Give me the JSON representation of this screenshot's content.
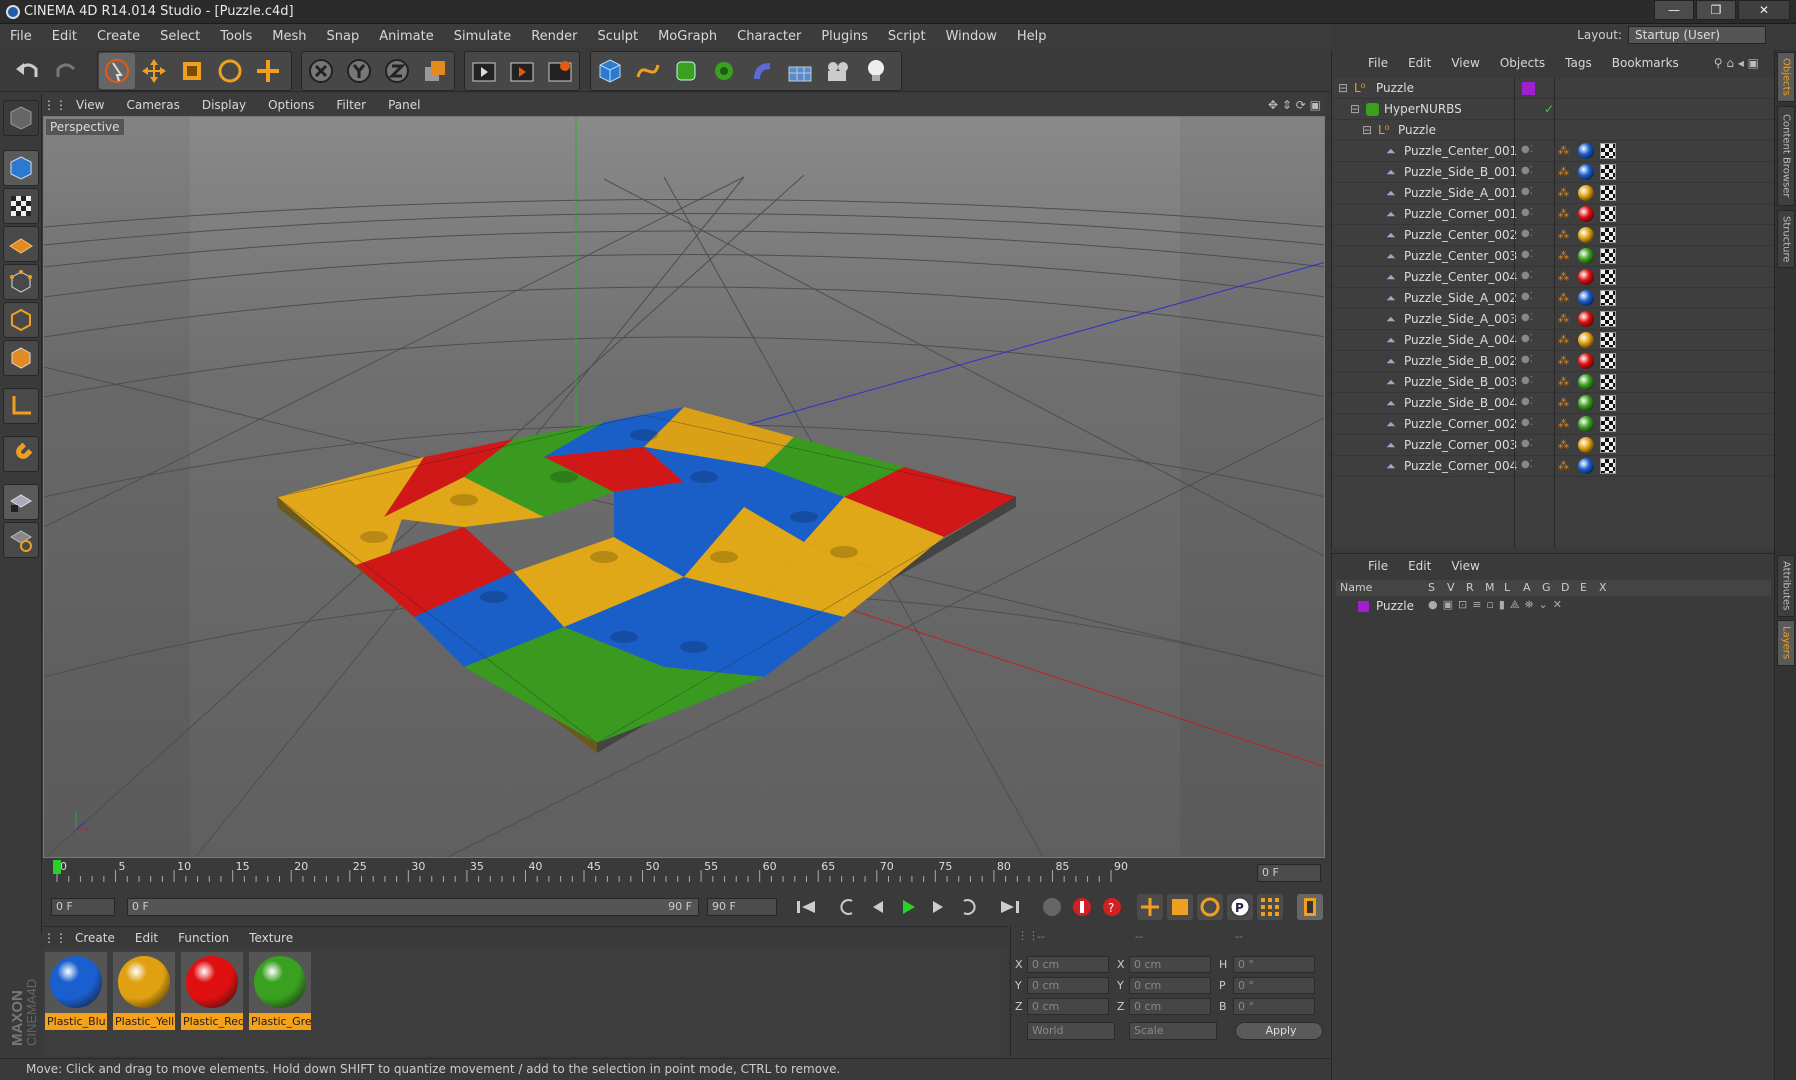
{
  "window": {
    "title": "CINEMA 4D R14.014 Studio - [Puzzle.c4d]",
    "controls": [
      "—",
      "❐",
      "✕"
    ]
  },
  "menu": [
    "File",
    "Edit",
    "Create",
    "Select",
    "Tools",
    "Mesh",
    "Snap",
    "Animate",
    "Simulate",
    "Render",
    "Sculpt",
    "MoGraph",
    "Character",
    "Plugins",
    "Script",
    "Window",
    "Help"
  ],
  "layout": {
    "label": "Layout:",
    "value": "Startup (User)"
  },
  "viewport": {
    "menu": [
      "View",
      "Cameras",
      "Display",
      "Options",
      "Filter",
      "Panel"
    ],
    "label": "Perspective"
  },
  "timeline": {
    "ticks": [
      "0",
      "5",
      "10",
      "15",
      "20",
      "25",
      "30",
      "35",
      "40",
      "45",
      "50",
      "55",
      "60",
      "65",
      "70",
      "75",
      "80",
      "85",
      "90"
    ],
    "frame_field": "0 F"
  },
  "transport": {
    "current": "0 F",
    "range_start": "0 F",
    "range_end": "90 F",
    "end": "90 F"
  },
  "materials": {
    "menu": [
      "Create",
      "Edit",
      "Function",
      "Texture"
    ],
    "items": [
      {
        "name": "Plastic_Blu",
        "color": "#1a5fd0"
      },
      {
        "name": "Plastic_Yell",
        "color": "#e0a010"
      },
      {
        "name": "Plastic_Red",
        "color": "#e01010"
      },
      {
        "name": "Plastic_Gre",
        "color": "#3aa020"
      }
    ]
  },
  "coords": {
    "header": [
      "--",
      "--",
      "--"
    ],
    "rows": [
      {
        "a": "X",
        "av": "0 cm",
        "b": "X",
        "bv": "0 cm",
        "c": "H",
        "cv": "0 °"
      },
      {
        "a": "Y",
        "av": "0 cm",
        "b": "Y",
        "bv": "0 cm",
        "c": "P",
        "cv": "0 °"
      },
      {
        "a": "Z",
        "av": "0 cm",
        "b": "Z",
        "bv": "0 cm",
        "c": "B",
        "cv": "0 °"
      }
    ],
    "mode1": "World",
    "mode2": "Scale",
    "apply": "Apply"
  },
  "status": "Move: Click and drag to move elements. Hold down SHIFT to quantize movement / add to the selection in point mode, CTRL to remove.",
  "objects": {
    "menu": [
      "File",
      "Edit",
      "View",
      "Objects",
      "Tags",
      "Bookmarks"
    ],
    "root": "Puzzle",
    "nurbs": "HyperNURBS",
    "group": "Puzzle",
    "items": [
      {
        "name": "Puzzle_Center_001",
        "mat": "#1a5fd0"
      },
      {
        "name": "Puzzle_Side_B_001",
        "mat": "#1a5fd0"
      },
      {
        "name": "Puzzle_Side_A_001",
        "mat": "#e0a010"
      },
      {
        "name": "Puzzle_Corner_001",
        "mat": "#e01010"
      },
      {
        "name": "Puzzle_Center_002",
        "mat": "#e0a010"
      },
      {
        "name": "Puzzle_Center_003",
        "mat": "#3aa020"
      },
      {
        "name": "Puzzle_Center_004",
        "mat": "#e01010"
      },
      {
        "name": "Puzzle_Side_A_002",
        "mat": "#1a5fd0"
      },
      {
        "name": "Puzzle_Side_A_003",
        "mat": "#e01010"
      },
      {
        "name": "Puzzle_Side_A_004",
        "mat": "#e0a010"
      },
      {
        "name": "Puzzle_Side_B_002",
        "mat": "#e01010"
      },
      {
        "name": "Puzzle_Side_B_003",
        "mat": "#3aa020"
      },
      {
        "name": "Puzzle_Side_B_004",
        "mat": "#3aa020"
      },
      {
        "name": "Puzzle_Corner_002",
        "mat": "#3aa020"
      },
      {
        "name": "Puzzle_Corner_003",
        "mat": "#e0a010"
      },
      {
        "name": "Puzzle_Corner_004",
        "mat": "#1a5fd0"
      }
    ]
  },
  "layers": {
    "menu": [
      "File",
      "Edit",
      "View"
    ],
    "columns": [
      "Name",
      "S",
      "V",
      "R",
      "M",
      "L",
      "A",
      "G",
      "D",
      "E",
      "X"
    ],
    "row": "Puzzle"
  },
  "right_tabs": [
    "Objects",
    "Content Browser",
    "Structure",
    "Attributes",
    "Layers"
  ]
}
